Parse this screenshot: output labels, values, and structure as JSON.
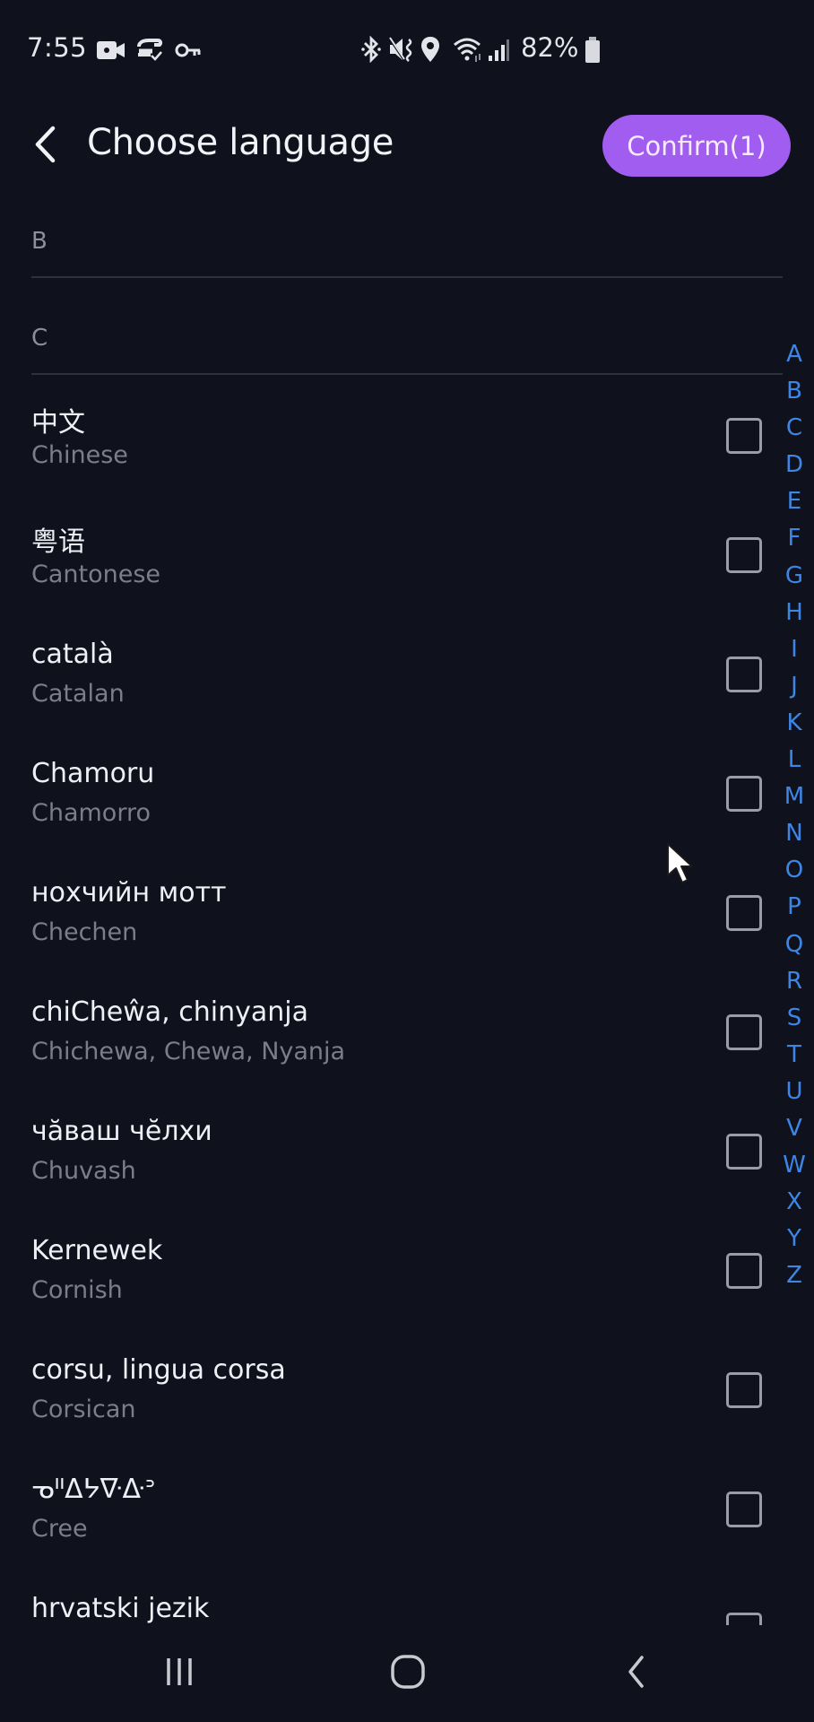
{
  "status_bar": {
    "time": "7:55",
    "left_icons": [
      "video-camera-icon",
      "sync-check-icon",
      "key-icon"
    ],
    "right_icons": [
      "bluetooth-icon",
      "mute-vibrate-icon",
      "location-icon",
      "wifi-icon",
      "signal-icon"
    ],
    "battery_percent": "82%",
    "battery_icon": "battery-icon"
  },
  "header": {
    "back_icon": "chevron-left-icon",
    "title": "Choose language",
    "confirm_label": "Confirm(1)",
    "confirm_color": "#a15cf0"
  },
  "sections": [
    {
      "letter": "B"
    },
    {
      "letter": "C"
    }
  ],
  "languages": [
    {
      "native": "中文",
      "english": "Chinese",
      "checked": false
    },
    {
      "native": "粤语",
      "english": "Cantonese",
      "checked": false
    },
    {
      "native": "català",
      "english": "Catalan",
      "checked": false
    },
    {
      "native": "Chamoru",
      "english": "Chamorro",
      "checked": false
    },
    {
      "native": "нохчийн мотт",
      "english": "Chechen",
      "checked": false
    },
    {
      "native": "chiCheŵa, chinyanja",
      "english": "Chichewa, Chewa, Nyanja",
      "checked": false
    },
    {
      "native": "чӑваш чӗлхи",
      "english": "Chuvash",
      "checked": false
    },
    {
      "native": "Kernewek",
      "english": "Cornish",
      "checked": false
    },
    {
      "native": "corsu, lingua corsa",
      "english": "Corsican",
      "checked": false
    },
    {
      "native": "ᓀᐦᐃᔭᐍᐏᐣ",
      "english": "Cree",
      "checked": false
    },
    {
      "native": "hrvatski jezik",
      "english": "",
      "checked": false
    }
  ],
  "alphabet_index": [
    "A",
    "B",
    "C",
    "D",
    "E",
    "F",
    "G",
    "H",
    "I",
    "J",
    "K",
    "L",
    "M",
    "N",
    "O",
    "P",
    "Q",
    "R",
    "S",
    "T",
    "U",
    "V",
    "W",
    "X",
    "Y",
    "Z"
  ],
  "index_color": "#3d86e6",
  "nav_bar": {
    "recents_icon": "recents-icon",
    "home_icon": "home-icon",
    "back_icon": "back-icon"
  }
}
